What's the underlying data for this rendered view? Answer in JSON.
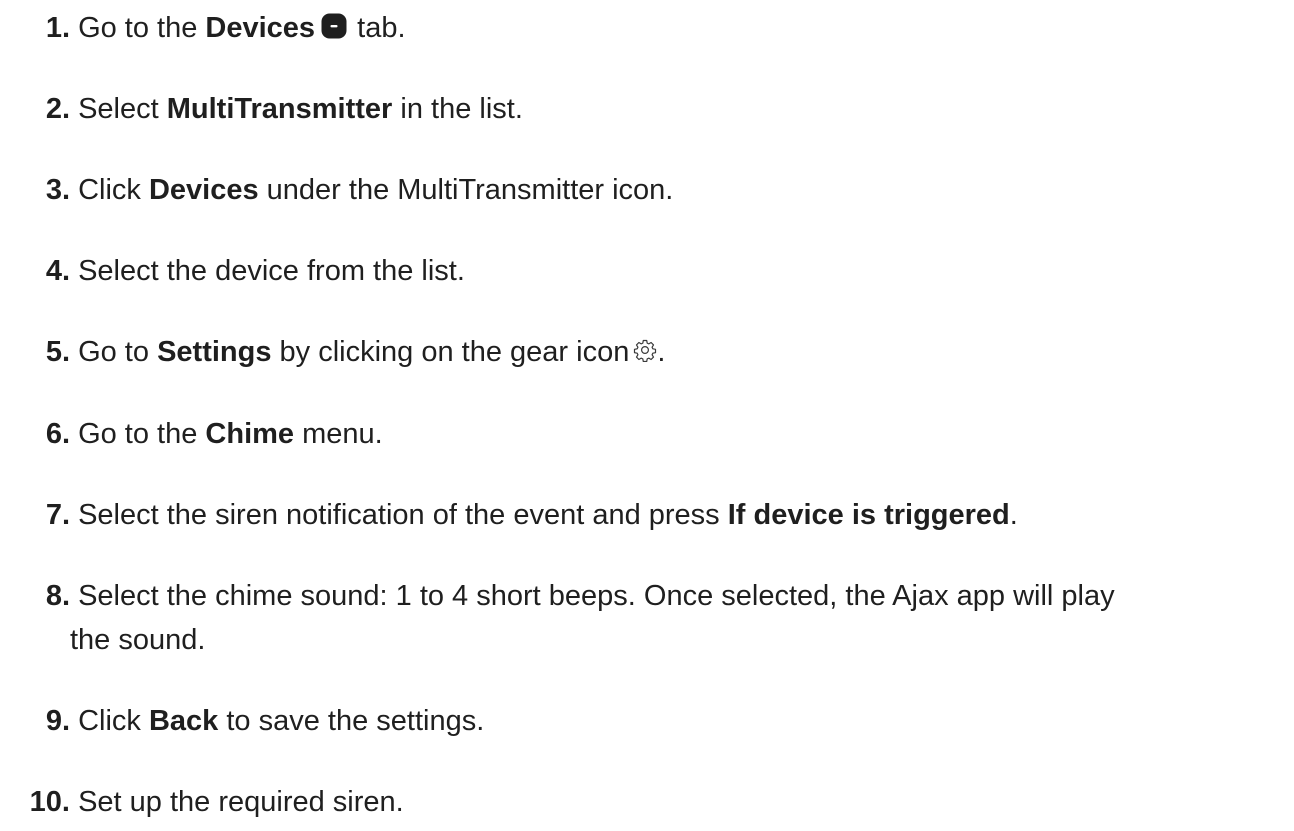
{
  "steps": [
    {
      "number": "1.",
      "before": "Go to the ",
      "bold": "Devices",
      "after": " tab.",
      "icon": "devices-tab-icon"
    },
    {
      "number": "2.",
      "before": "Select ",
      "bold": "MultiTransmitter",
      "after": " in the list."
    },
    {
      "number": "3.",
      "before": "Click ",
      "bold": "Devices",
      "after": " under the MultiTransmitter icon."
    },
    {
      "number": "4.",
      "text": "Select the device from the list."
    },
    {
      "number": "5.",
      "before": "Go to ",
      "bold": "Settings",
      "after": " by clicking on the gear icon",
      "icon": "gear-icon",
      "after_icon": "."
    },
    {
      "number": "6.",
      "before": "Go to the ",
      "bold": "Chime",
      "after": " menu."
    },
    {
      "number": "7.",
      "before": "Select the siren notification of the event and press ",
      "bold": "If device is triggered",
      "after": "."
    },
    {
      "number": "8.",
      "line1": "Select the chime sound: 1 to 4 short beeps. Once selected, the Ajax app will play",
      "line2": "the sound."
    },
    {
      "number": "9.",
      "before": "Click ",
      "bold": "Back",
      "after": " to save the settings."
    },
    {
      "number": "10.",
      "text": "Set up the required siren."
    }
  ],
  "colors": {
    "text": "#1f1f1f",
    "icon_fill": "#1f1f1f",
    "icon_mark": "#ffffff",
    "gear_stroke": "#3a3a3a"
  }
}
